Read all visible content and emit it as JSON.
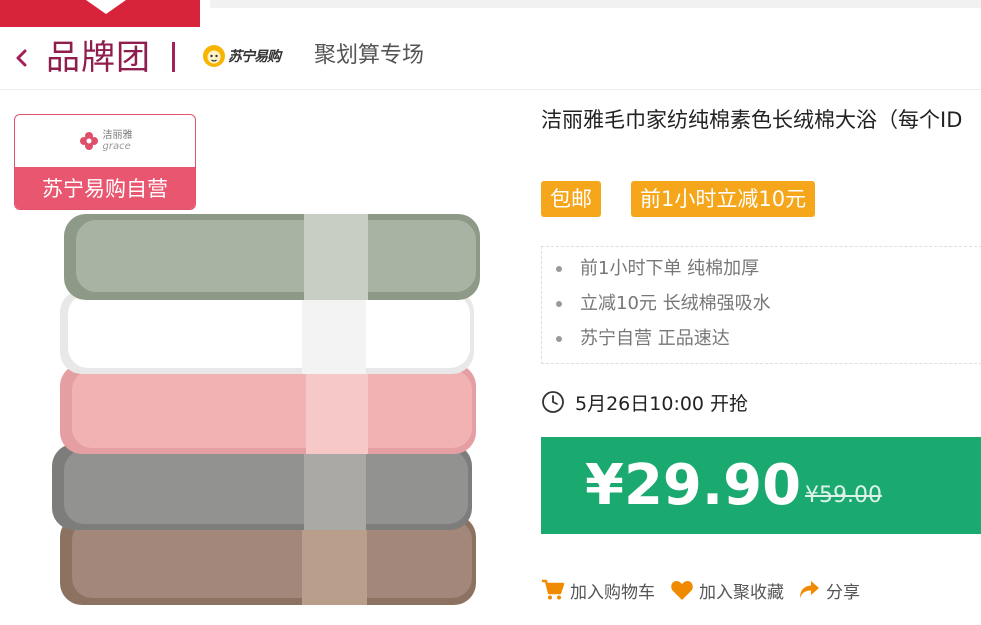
{
  "header": {
    "back_icon": "chevron-left-icon",
    "brand_title": "品牌团",
    "store_logo_text": "苏宁易购",
    "sub_title": "聚划算专场"
  },
  "image": {
    "badge_logo_cn": "洁丽雅",
    "badge_logo_en": "grace",
    "badge_label": "苏宁易购自营"
  },
  "product": {
    "title": "洁丽雅毛巾家纺纯棉素色长绒棉大浴（每个ID",
    "tags": [
      "包邮",
      "前1小时立减10元"
    ],
    "features": [
      "前1小时下单 纯棉加厚",
      "立减10元 长绒棉强吸水",
      "苏宁自营 正品速达"
    ],
    "sale_time": "5月26日10:00 开抢",
    "price": "¥29.90",
    "original_price": "¥59.00"
  },
  "actions": {
    "cart": "加入购物车",
    "favorite": "加入聚收藏",
    "share": "分享"
  },
  "colors": {
    "accent_green": "#1aaa70",
    "tag_orange": "#f6a61a",
    "brand_purple": "#8f1d4e",
    "badge_pink": "#e9566f",
    "action_orange": "#f08a00"
  }
}
